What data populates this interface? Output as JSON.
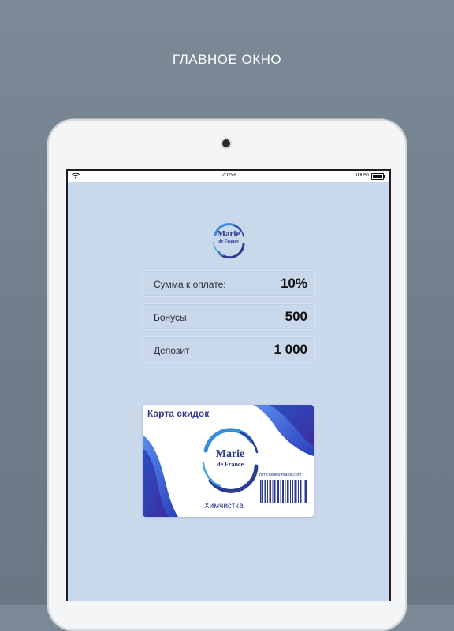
{
  "headline": "ГЛАВНОЕ ОКНО",
  "status_bar": {
    "time": "20:59",
    "battery": "100%"
  },
  "logo": {
    "line1": "Marie",
    "line2": "de France"
  },
  "rows": [
    {
      "label": "Сумма к оплате:",
      "value": "10%"
    },
    {
      "label": "Бонусы",
      "value": "500"
    },
    {
      "label": "Депозит",
      "value": "1 000"
    }
  ],
  "card": {
    "title": "Карта скидок",
    "logo_line1": "Marie",
    "logo_line2": "de France",
    "url": "himchistka-maria.com",
    "caption": "Химчистка"
  },
  "colors": {
    "brand": "#2d3c8f",
    "accent": "#3a6fd8",
    "screen_bg": "#c9d8ea"
  }
}
